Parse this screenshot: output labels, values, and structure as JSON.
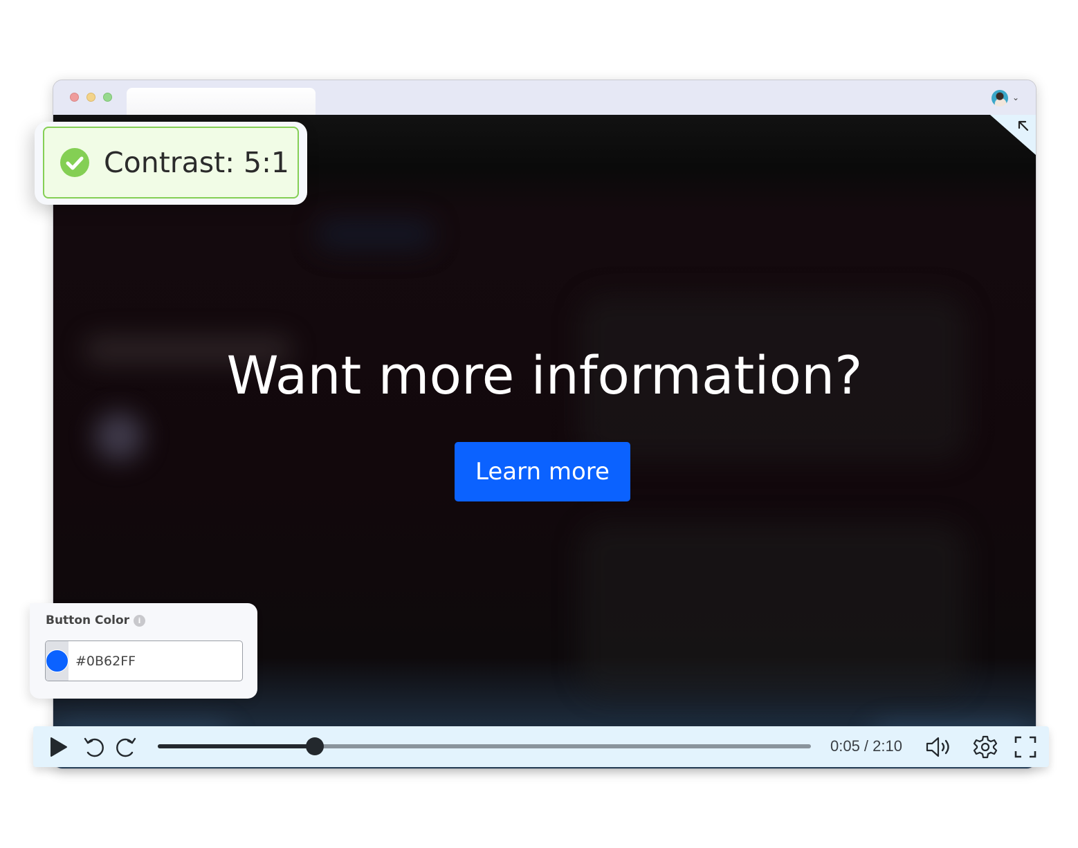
{
  "browser": {
    "tab_title": "",
    "avatar_label": "user-avatar"
  },
  "video": {
    "headline": "Want more information?",
    "cta_label": "Learn more",
    "cta_color": "#0B62FF",
    "collapse_icon": "↖"
  },
  "contrast_badge": {
    "label": "Contrast: 5:1",
    "status": "pass",
    "status_color": "#84CF54"
  },
  "color_panel": {
    "label": "Button Color",
    "info_icon": "i",
    "value": "#0B62FF",
    "swatch_color": "#0B62FF"
  },
  "player": {
    "current_time": "0:05",
    "duration": "2:10",
    "time_display": "0:05 / 2:10",
    "progress": 0.24
  }
}
